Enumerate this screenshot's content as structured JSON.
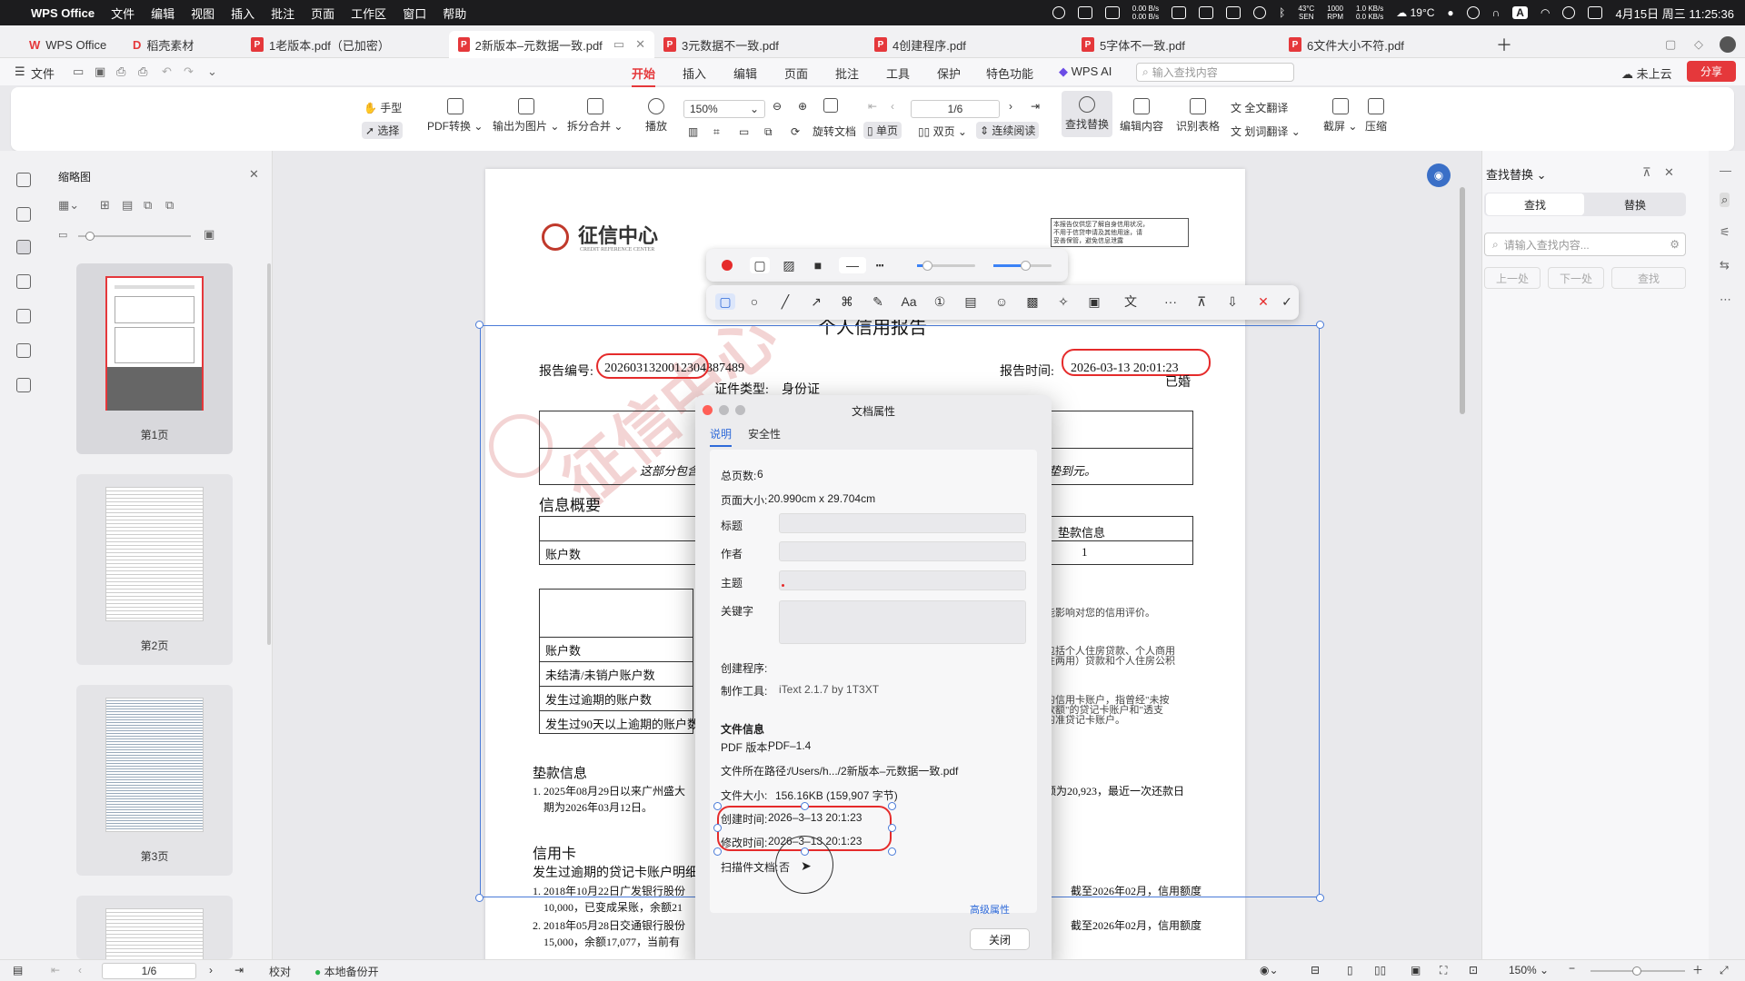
{
  "menubar": {
    "app": "WPS Office",
    "items": [
      "文件",
      "编辑",
      "视图",
      "插入",
      "批注",
      "页面",
      "工作区",
      "窗口",
      "帮助"
    ],
    "net_up": "0.00 B/s",
    "net_down": "0.00 B/s",
    "cpu_temp": "43°C",
    "cpu_temp_label": "SEN",
    "fan": "1000",
    "fan_label": "RPM",
    "disk_r": "1.0 KB/s",
    "disk_w": "0.0 KB/s",
    "weather": "19°C",
    "input_method": "A",
    "datetime": "4月15日 周三 11:25:36"
  },
  "tabs": [
    {
      "label": "WPS Office",
      "type": "wps"
    },
    {
      "label": "稻壳素材",
      "type": "wps"
    },
    {
      "label": "1老版本.pdf（已加密）",
      "type": "pdf"
    },
    {
      "label": "2新版本–元数据一致.pdf",
      "type": "pdf",
      "active": true
    },
    {
      "label": "3元数据不一致.pdf",
      "type": "pdf"
    },
    {
      "label": "4创建程序.pdf",
      "type": "pdf"
    },
    {
      "label": "5字体不一致.pdf",
      "type": "pdf"
    },
    {
      "label": "6文件大小不符.pdf",
      "type": "pdf"
    }
  ],
  "ribbon": {
    "file": "文件",
    "tabs": [
      "开始",
      "插入",
      "编辑",
      "页面",
      "批注",
      "工具",
      "保护",
      "特色功能"
    ],
    "ai": "WPS AI",
    "search_placeholder": "输入查找内容",
    "cloud": "未上云",
    "share": "分享"
  },
  "toolbar": {
    "hand": "手型",
    "select": "选择",
    "pdf_convert": "PDF转换",
    "export_image": "输出为图片",
    "split_merge": "拆分合并",
    "play": "播放",
    "zoom": "150%",
    "page_indicator": "1/6",
    "rotate": "旋转文档",
    "single": "单页",
    "double": "双页",
    "continuous": "连续阅读",
    "find_replace": "查找替换",
    "edit_content": "编辑内容",
    "recognize_table": "识别表格",
    "translate_full": "全文翻译",
    "translate_word": "划词翻译",
    "screenshot": "截屏",
    "compress": "压缩"
  },
  "thumbnails": {
    "title": "缩略图",
    "pages": [
      "第1页",
      "第2页",
      "第3页"
    ]
  },
  "document": {
    "title": "个人信用报告",
    "report_no_label": "报告编号:",
    "report_no": "2026031320012304387489",
    "report_time_label": "报告时间:",
    "report_time": "2026-03-13 20:01:23",
    "id_type_label": "证件类型:",
    "id_type": "身份证",
    "marital": "已婚",
    "partial_note": "这部分包含",
    "right_note": "垫到元。",
    "summary_title": "信息概要",
    "accounts": "账户数",
    "advance_info": "垫款信息",
    "advance_count": "1",
    "impact_note": "能影响对您的信用评价。",
    "rows": [
      "账户数",
      "未结清/未销户账户数",
      "发生过逾期的账户数",
      "发生过90天以上逾期的账户数"
    ],
    "right_para1": [
      "包括个人住房贷款、个人商用",
      "住两用）贷款和个人住房公积"
    ],
    "right_para2": [
      "的信用卡账户，指曾经\"未按",
      "款额\"的贷记卡账户和\"透支",
      "的准贷记卡账户。"
    ],
    "advance_section": "垫款信息",
    "advance_line1": "1. 2025年08月29日以来广州盛大",
    "advance_line2": "期为2026年03月12日。",
    "advance_right": "额为20,923，最近一次还款日",
    "credit_card": "信用卡",
    "overdue_title": "发生过逾期的贷记卡账户明细",
    "cc_line1": "1. 2018年10月22日广发银行股份",
    "cc_line1b": "10,000，已变成呆账，余额21",
    "cc_line2": "2. 2018年05月28日交通银行股份",
    "cc_line2b": "15,000，余额17,077，当前有",
    "cc_right1": "截至2026年02月，信用额度",
    "cc_right2": "截至2026年02月，信用额度",
    "logo_text": "征信中心",
    "logo_sub": "CREDIT REFERENCE CENTER",
    "corner_note": [
      "本报告仅供您了解自身信用状况，",
      "不用于信贷申请及其他用途，请",
      "妥善保管，避免信息泄露"
    ],
    "watermark": "征信中心"
  },
  "dialog": {
    "title": "文档属性",
    "tabs": [
      "说明",
      "安全性"
    ],
    "total_pages_label": "总页数:",
    "total_pages": "6",
    "page_size_label": "页面大小:",
    "page_size": "20.990cm x 29.704cm",
    "title_label": "标题",
    "author_label": "作者",
    "subject_label": "主题",
    "keywords_label": "关键字",
    "creator_label": "创建程序:",
    "creator": "",
    "producer_label": "制作工具:",
    "producer": "iText 2.1.7 by 1T3XT",
    "file_info": "文件信息",
    "pdf_version_label": "PDF 版本:",
    "pdf_version": "PDF–1.4",
    "path_label": "文件所在路径:",
    "path": "/Users/h.../2新版本–元数据一致.pdf",
    "size_label": "文件大小:",
    "size": "156.16KB (159,907 字节)",
    "created_label": "创建时间:",
    "created": "2026–3–13 20:1:23",
    "modified_label": "修改时间:",
    "modified": "2026–3–13 20:1:23",
    "scanned_label": "扫描件文档:",
    "scanned": "否",
    "advanced": "高级属性",
    "close": "关闭"
  },
  "findpanel": {
    "title": "查找替换",
    "tab_find": "查找",
    "tab_replace": "替换",
    "placeholder": "请输入查找内容...",
    "prev": "上一处",
    "next": "下一处",
    "find": "查找"
  },
  "statusbar": {
    "page": "1/6",
    "proofread": "校对",
    "backup": "本地备份开",
    "zoom": "150%"
  },
  "colors": {
    "accent": "#e5383b",
    "selection": "#4a7bd8",
    "annotation": "#e52b2b"
  }
}
